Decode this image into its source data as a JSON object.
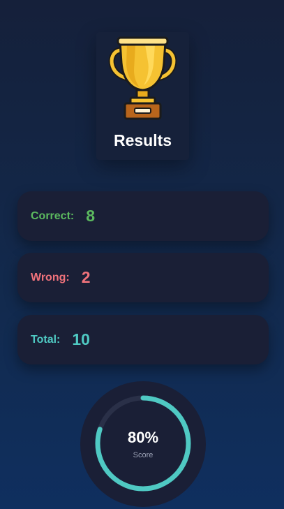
{
  "header": {
    "title": "Results",
    "icon": "trophy-icon"
  },
  "stats": {
    "correct": {
      "label": "Correct:",
      "value": "8",
      "color": "#5cba5f"
    },
    "wrong": {
      "label": "Wrong:",
      "value": "2",
      "color": "#f0727b"
    },
    "total": {
      "label": "Total:",
      "value": "10",
      "color": "#4fc9c3"
    }
  },
  "score": {
    "percent_text": "80%",
    "label": "Score",
    "progress": 0.8,
    "ring_color": "#4fc9c3",
    "track_color": "#2a3048"
  }
}
